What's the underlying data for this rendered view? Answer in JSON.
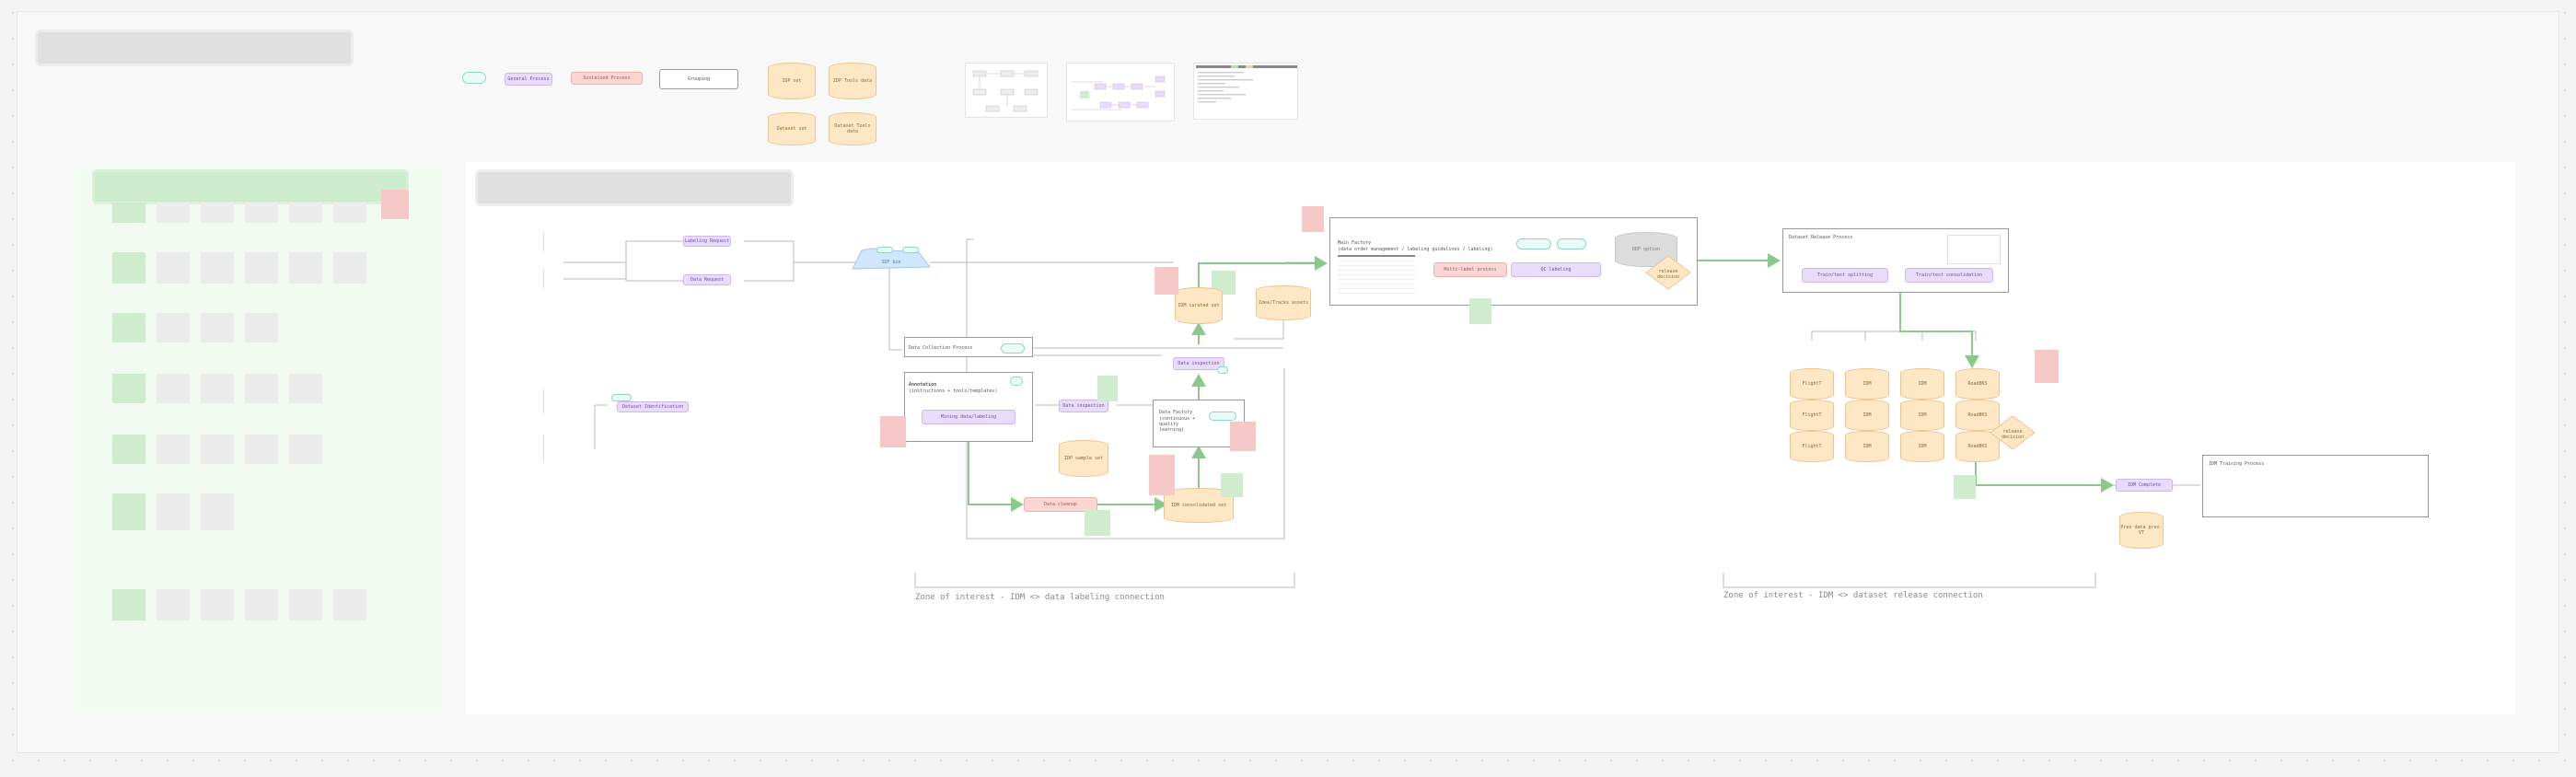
{
  "canvas": {
    "background": "#f4f4f4"
  },
  "legend": {
    "flow_label": "",
    "process_label": "General Process",
    "sustained_label": "Sustained Process",
    "group_label": "Grouping",
    "cyl_1": "IDP set",
    "cyl_2": "IDP Tools data",
    "cyl_3": "Dataset set",
    "cyl_4": "Dataset Tools data"
  },
  "labeling": {
    "labeling_request": "Labeling Request",
    "data_request": "Data Request",
    "dataset_identification": "Dataset Identification",
    "sdf_bin": "SDF bin",
    "data_collection_process": "Data Collection Process",
    "annotation_title": "Annotation",
    "annotation_sub": "(instructions + tools/templates)",
    "annotation_inner": "Mining data/labeling",
    "data_inspection_1": "Data inspection",
    "data_inspection_2": "Data inspection",
    "idp_sample_set": "IDP sample set",
    "data_cleanup": "Data cleanup",
    "idm_consolidated": "IDM consolidated set",
    "idm_curated": "IDM curated set",
    "ideation_assets": "Idea/Tracks assets",
    "data_factory_title": "Data Factory",
    "data_factory_sub": "(continuous + quality learning)",
    "main_factory_title": "Main Factory",
    "main_factory_sub": "(data order management / labeling guidelines / labeling)",
    "multi_label_process": "Multi-label process",
    "qc_labeling": "QC labeling",
    "ddf_option": "DDF option",
    "release_decision": "release decision"
  },
  "release": {
    "dataset_release": "Dataset Release Process",
    "train_test_splitting": "Train/test splitting",
    "train_test_consolidation": "Train/test consolidation",
    "cyl_rows": [
      [
        "FlightT",
        "IDM",
        "IDM",
        "RoadBKS"
      ],
      [
        "FlightT",
        "IDM",
        "IDM",
        "RoadBKS"
      ],
      [
        "FlightT",
        "IDM",
        "IDM",
        "RoadBKS"
      ]
    ],
    "idm_complete": "IDM Complete",
    "ide_training": "IDM Training Process",
    "prev_data": "Prev data prev-VT",
    "release_decision": "release decision"
  },
  "captions": {
    "labeling_zone": "Zone of interest - IDM <> data labeling connection",
    "release_zone": "Zone of interest - IDM <> dataset release connection"
  }
}
